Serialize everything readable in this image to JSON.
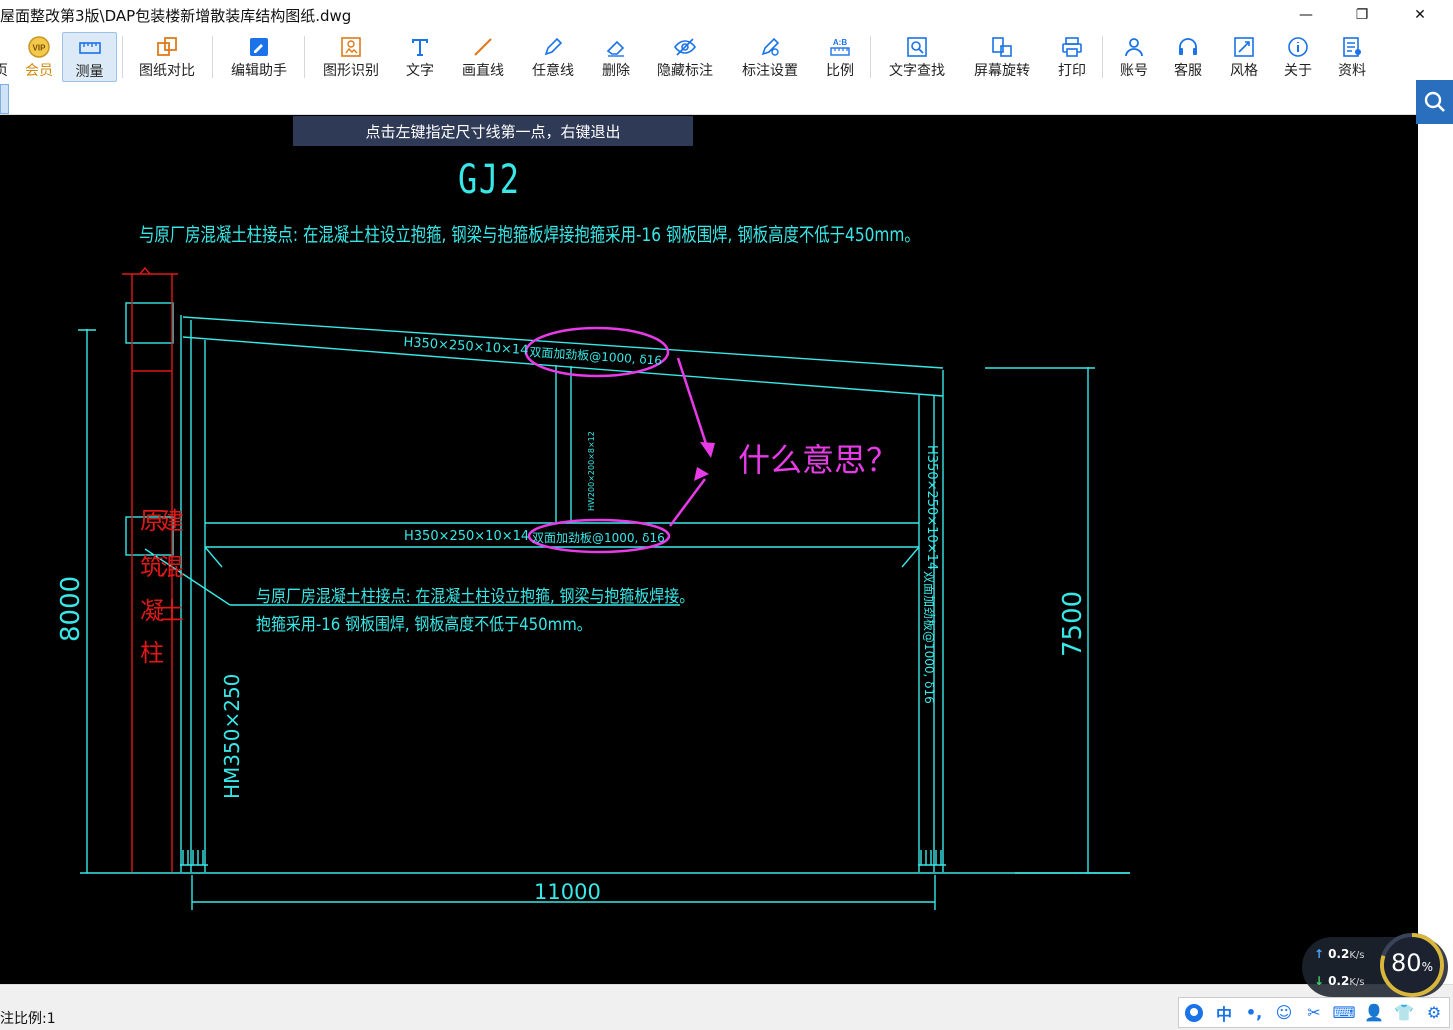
{
  "window": {
    "title": "屋面整改第3版\\DAP包装楼新增散装库结构图纸.dwg",
    "minimize": "—",
    "maximize": "❐",
    "close": "✕"
  },
  "toolbar": {
    "edge_label": "页",
    "items": [
      {
        "name": "member",
        "label": "会员"
      },
      {
        "name": "measure",
        "label": "测量"
      },
      {
        "name": "compare",
        "label": "图纸对比"
      },
      {
        "name": "edit-assistant",
        "label": "编辑助手"
      },
      {
        "name": "shape-recognize",
        "label": "图形识别"
      },
      {
        "name": "text",
        "label": "文字"
      },
      {
        "name": "draw-line",
        "label": "画直线"
      },
      {
        "name": "freehand-line",
        "label": "任意线"
      },
      {
        "name": "delete",
        "label": "删除"
      },
      {
        "name": "hide-annotation",
        "label": "隐藏标注"
      },
      {
        "name": "annotation-settings",
        "label": "标注设置"
      },
      {
        "name": "scale",
        "label": "比例"
      },
      {
        "name": "text-search",
        "label": "文字查找"
      },
      {
        "name": "screen-rotate",
        "label": "屏幕旋转"
      },
      {
        "name": "print",
        "label": "打印"
      },
      {
        "name": "account",
        "label": "账号"
      },
      {
        "name": "service",
        "label": "客服"
      },
      {
        "name": "style",
        "label": "风格"
      },
      {
        "name": "about",
        "label": "关于"
      },
      {
        "name": "resources",
        "label": "资料"
      }
    ],
    "active": "measure",
    "vip_badge": "VIP"
  },
  "canvas": {
    "hint": "点击左键指定尺寸线第一点，右键退出",
    "drawing_title": "GJ2",
    "note_top": "与原厂房混凝土柱接点: 在混凝土柱设立抱箍, 钢梁与抱箍板焊接抱箍采用-16 钢板围焊, 钢板高度不低于450mm。",
    "note_mid_line1": "与原厂房混凝土柱接点: 在混凝土柱设立抱箍, 钢梁与抱箍板焊接。",
    "note_mid_line2": "抱箍采用-16 钢板围焊, 钢板高度不低于450mm。",
    "beam_top_label": "H350×250×10×14",
    "beam_mid_label": "H350×250×10×14",
    "stiffener_top": "双面加劲板@1000, δ16",
    "stiffener_mid": "双面加劲板@1000, δ16",
    "strut_label": "HW200×200×8×12",
    "right_col_label": "H350×250×10×14",
    "right_col_stiffener": "双面加劲板@1000, δ16",
    "left_col_label": "HM350×250",
    "question": "什么意思？",
    "concrete_col_chars": [
      "原",
      "建",
      "筑",
      "混",
      "凝",
      "土",
      "柱"
    ],
    "dim_height_left": "8000",
    "dim_height_right": "7500",
    "dim_span": "11000",
    "colors": {
      "cad_cyan": "#38e8e8",
      "annotation_magenta": "#e83be8",
      "concrete_red": "#e01818",
      "canvas_bg": "#000000"
    }
  },
  "status": {
    "scale_label": "注比例:1"
  },
  "net_widget": {
    "up": "0.2",
    "down": "0.2",
    "unit": "K/s",
    "percent": "80",
    "percent_sign": "%"
  },
  "ime": {
    "items": [
      "中",
      "•,",
      "☺",
      "✂",
      "⌨",
      "👤",
      "👕",
      "⚙"
    ]
  }
}
